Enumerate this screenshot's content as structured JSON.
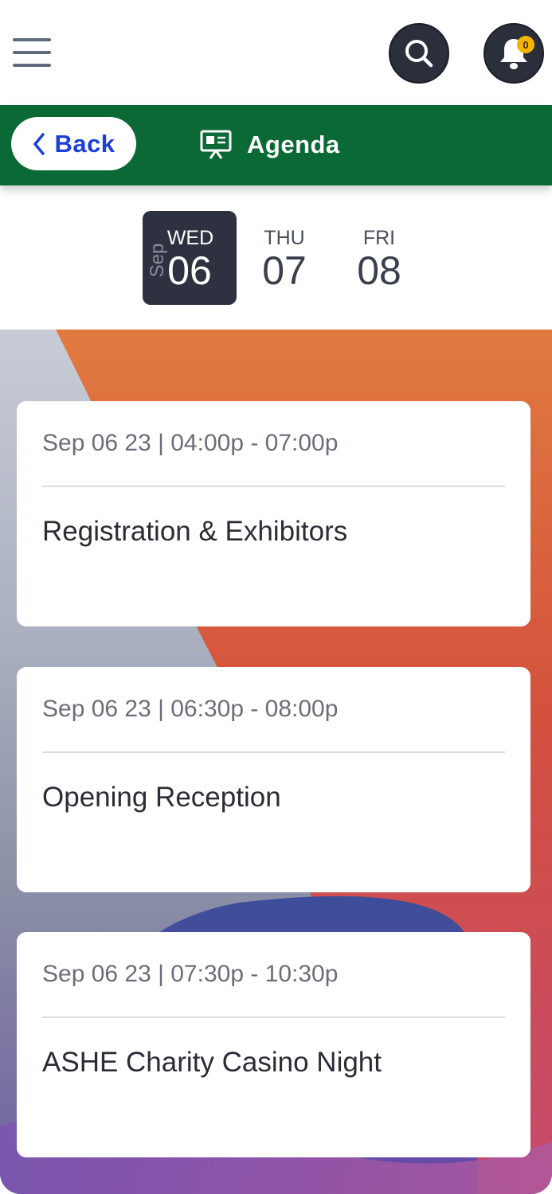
{
  "header": {
    "menu_icon": "hamburger-menu-icon",
    "search_icon": "search-icon",
    "bell_icon": "bell-icon",
    "notification_count": "0"
  },
  "titlebar": {
    "back_label": "Back",
    "title": "Agenda",
    "title_icon": "presentation-board-icon",
    "bar_color": "#0a6934"
  },
  "dates": {
    "month": "Sep",
    "days": [
      {
        "dow": "WED",
        "num": "06",
        "selected": true
      },
      {
        "dow": "THU",
        "num": "07",
        "selected": false
      },
      {
        "dow": "FRI",
        "num": "08",
        "selected": false
      }
    ]
  },
  "sessions": [
    {
      "time": "Sep 06 23 | 04:00p - 07:00p",
      "title": "Registration & Exhibitors"
    },
    {
      "time": "Sep 06 23 | 06:30p - 08:00p",
      "title": "Opening Reception"
    },
    {
      "time": "Sep 06 23 | 07:30p - 10:30p",
      "title": "ASHE Charity Casino Night"
    }
  ]
}
